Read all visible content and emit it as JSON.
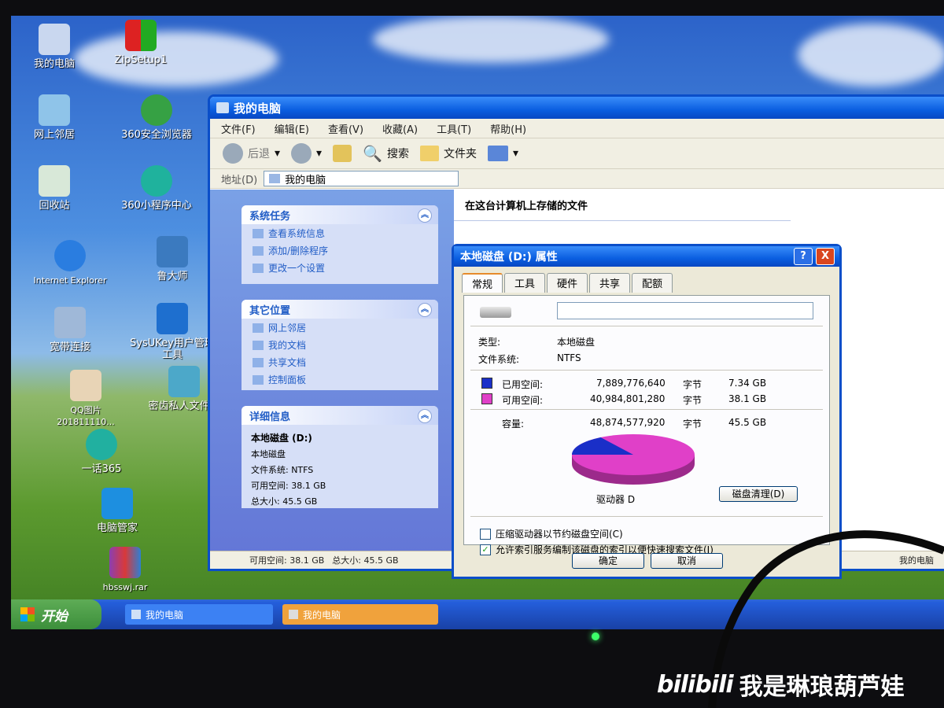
{
  "desktop": {
    "icons": [
      {
        "label": "我的电脑",
        "icon": "computer-icon"
      },
      {
        "label": "ZipSetup1",
        "icon": "installer-icon"
      },
      {
        "label": "网上邻居",
        "icon": "network-icon"
      },
      {
        "label": "360安全浏览器",
        "icon": "browser-icon"
      },
      {
        "label": "回收站",
        "icon": "recycle-bin-icon"
      },
      {
        "label": "360小程序中心",
        "icon": "app-center-icon"
      },
      {
        "label": "Internet Explorer",
        "icon": "ie-icon"
      },
      {
        "label": "鲁大师",
        "icon": "benchmark-icon"
      },
      {
        "label": "宽带连接",
        "icon": "broadband-icon"
      },
      {
        "label": "SysUKey用户管理工具",
        "icon": "ukey-icon"
      },
      {
        "label": "QQ图片201811110...",
        "icon": "image-icon"
      },
      {
        "label": "密齿私人文件柜",
        "icon": "safe-icon"
      },
      {
        "label": "一话365",
        "icon": "app-icon"
      },
      {
        "label": "电脑管家",
        "icon": "shield-icon"
      },
      {
        "label": "hbsswj.rar",
        "icon": "archive-icon"
      }
    ]
  },
  "explorer": {
    "title": "我的电脑",
    "menu": [
      "文件(F)",
      "编辑(E)",
      "查看(V)",
      "收藏(A)",
      "工具(T)",
      "帮助(H)"
    ],
    "toolbar": {
      "back": "后退",
      "search": "搜索",
      "folders": "文件夹"
    },
    "address": {
      "label": "地址(D)",
      "value": "我的电脑"
    },
    "content_title": "在这台计算机上存储的文件",
    "system_tasks": {
      "title": "系统任务",
      "items": [
        "查看系统信息",
        "添加/删除程序",
        "更改一个设置"
      ]
    },
    "other_places": {
      "title": "其它位置",
      "items": [
        "网上邻居",
        "我的文档",
        "共享文档",
        "控制面板"
      ]
    },
    "details": {
      "title": "详细信息",
      "name": "本地磁盘 (D:)",
      "type": "本地磁盘",
      "fs": "文件系统: NTFS",
      "free": "可用空间: 38.1 GB",
      "total": "总大小: 45.5 GB"
    },
    "status": {
      "free": "可用空间: 38.1 GB",
      "total": "总大小: 45.5 GB",
      "location": "我的电脑"
    }
  },
  "dialog": {
    "title": "本地磁盘 (D:) 属性",
    "help_btn": "?",
    "close_btn": "X",
    "tabs": [
      "常规",
      "工具",
      "硬件",
      "共享",
      "配额"
    ],
    "label_value": "",
    "type_label": "类型:",
    "type_value": "本地磁盘",
    "fs_label": "文件系统:",
    "fs_value": "NTFS",
    "used_label": "已用空间:",
    "used_bytes": "7,889,776,640",
    "used_unit": "字节",
    "used_gb": "7.34 GB",
    "free_label": "可用空间:",
    "free_bytes": "40,984,801,280",
    "free_unit": "字节",
    "free_gb": "38.1 GB",
    "cap_label": "容量:",
    "cap_bytes": "48,874,577,920",
    "cap_unit": "字节",
    "cap_gb": "45.5 GB",
    "drive_label": "驱动器 D",
    "cleanup_btn": "磁盘清理(D)",
    "compress_label": "压缩驱动器以节约磁盘空间(C)",
    "index_label": "允许索引服务编制该磁盘的索引以便快速搜索文件(I)",
    "ok": "确定",
    "cancel": "取消",
    "used_color": "#1a2fc8",
    "free_color": "#e040c8",
    "used_fraction": 0.161
  },
  "taskbar": {
    "start": "开始",
    "items": [
      "我的电脑",
      "我的电脑"
    ]
  },
  "watermark": {
    "logo": "bilibili",
    "text": "我是琳琅葫芦娃"
  }
}
